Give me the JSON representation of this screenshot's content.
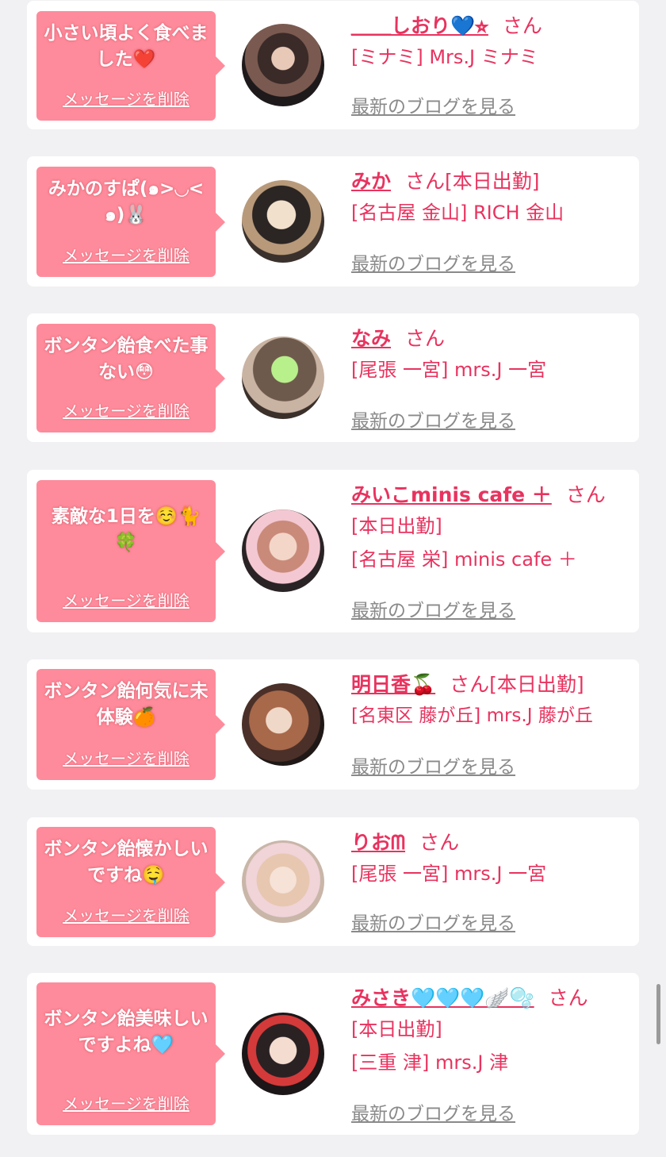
{
  "delete_label": "メッセージを削除",
  "blog_label": "最新のブログを見る",
  "colors": {
    "accent": "#e8335f",
    "bubble": "#fe8b9b",
    "background": "#f1f1f3"
  },
  "cards": [
    {
      "message": "小さい頃よく食べました❤️",
      "name": "＿＿しおり💙⭐︎",
      "san": "さん",
      "lines": [
        "[ミナミ] Mrs.J ミナミ"
      ]
    },
    {
      "message": "みかのすぱ(๑>◡<๑)🐰",
      "name": "みか",
      "san": "さん[本日出勤]",
      "lines": [
        "[名古屋 金山] RICH 金山"
      ]
    },
    {
      "message": "ボンタン飴食べた事ない😳",
      "name": "なみ",
      "san": "さん",
      "lines": [
        "[尾張 一宮] mrs.J 一宮"
      ]
    },
    {
      "message": "素敵な1日を☺️🐈🍀",
      "name": "みいこminis cafe ＋",
      "san": "さん",
      "lines": [
        "[本日出勤]",
        "[名古屋 栄] minis cafe ＋"
      ]
    },
    {
      "message": "ボンタン飴何気に未体験🍊",
      "name": "明日香🍒",
      "san": "さん[本日出勤]",
      "lines": [
        "[名東区 藤が丘] mrs.J 藤が丘"
      ]
    },
    {
      "message": "ボンタン飴懐かしいですね🤤",
      "name": "りおᗰ",
      "san": "さん",
      "lines": [
        "[尾張 一宮] mrs.J 一宮"
      ]
    },
    {
      "message": "ボンタン飴美味しいですよね🩵",
      "name": "みさき🩵🩵🩵🪽🫧",
      "san": "さん",
      "lines": [
        "[本日出勤]",
        "[三重 津] mrs.J 津"
      ]
    }
  ]
}
